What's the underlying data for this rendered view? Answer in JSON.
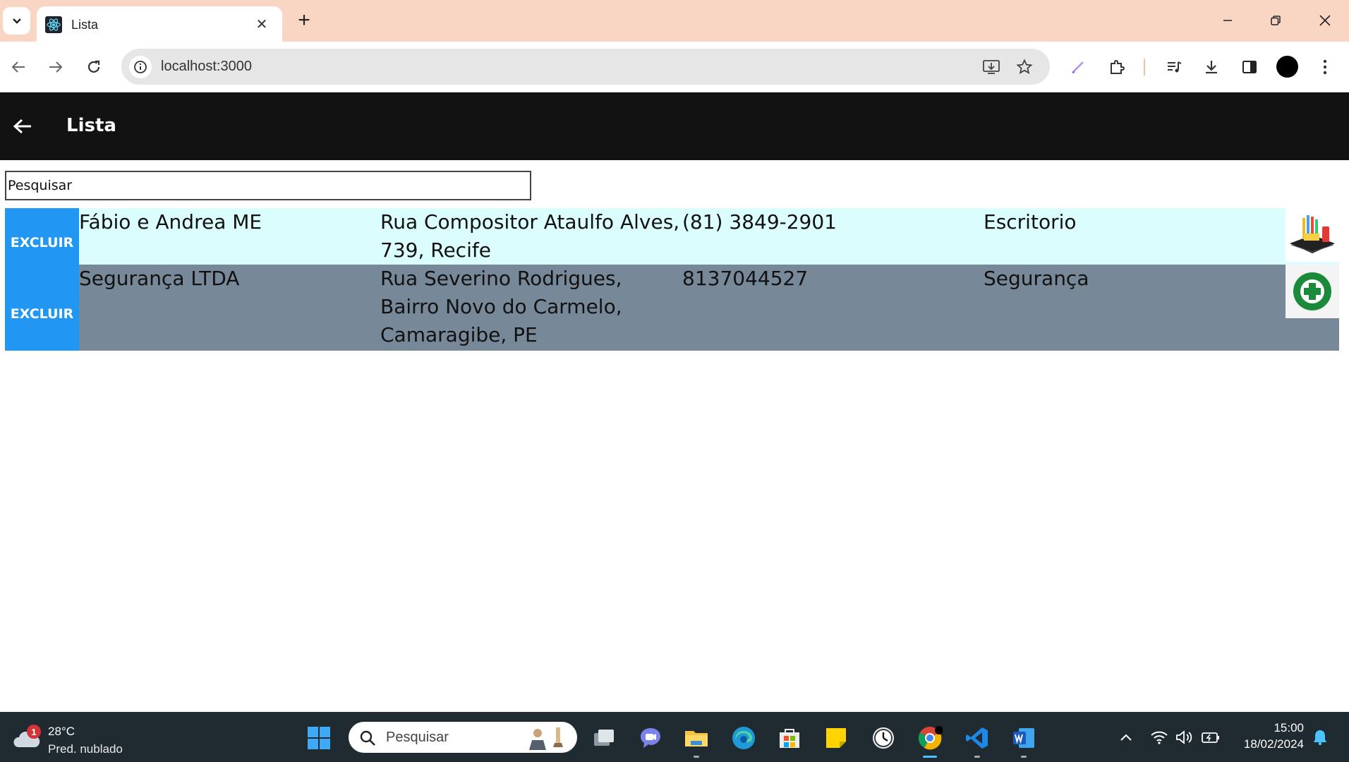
{
  "browser": {
    "tab_title": "Lista",
    "url": "localhost:3000"
  },
  "app": {
    "title": "Lista",
    "search_placeholder": "Pesquisar",
    "delete_label": "EXCLUIR",
    "rows": [
      {
        "name": "Fábio e Andrea ME",
        "address": "Rua Compositor Ataulfo Alves, 739, Recife",
        "phone": "(81) 3849-2901",
        "category": "Escritorio",
        "image": "office-supplies-thumbnail",
        "background": "#dbfdfd"
      },
      {
        "name": "Segurança LTDA",
        "address": "Rua Severino Rodrigues, Bairro Novo do Carmelo, Camaragibe, PE",
        "phone": "8137044527",
        "category": "Segurança",
        "image": "cipa-seguranca-logo",
        "background": "#778899"
      }
    ],
    "colors": {
      "appbar": "#121212",
      "delete_button": "#2196f3"
    }
  },
  "taskbar": {
    "weather_temp": "28°C",
    "weather_desc": "Pred. nublado",
    "weather_badge": "1",
    "search_label": "Pesquisar",
    "time": "15:00",
    "date": "18/02/2024"
  }
}
